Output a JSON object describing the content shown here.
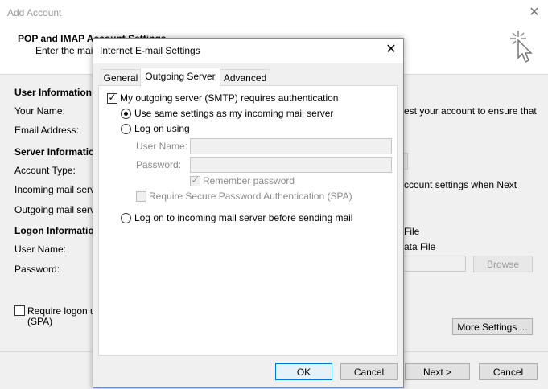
{
  "background_window": {
    "title": "Add Account",
    "header_title": "POP and IMAP Account Settings",
    "header_subtitle": "Enter the mail server settings for your account.",
    "sections": {
      "user_information": "User Information",
      "your_name": "Your Name:",
      "email_address": "Email Address:",
      "server_information": "Server Information",
      "account_type": "Account Type:",
      "incoming_mail_server": "Incoming mail server:",
      "outgoing_mail_server": "Outgoing mail server (SMTP):",
      "logon_information": "Logon Information",
      "user_name": "User Name:",
      "password": "Password:"
    },
    "right_text_1": "est your account to ensure that",
    "right_text_2": "ccount settings when Next",
    "right_text_3": "File",
    "right_text_4": "ata File",
    "browse_label": "Browse",
    "require_logon_label": "Require logon using Secure Password Authentication",
    "spa_label": "(SPA)",
    "more_settings_label": "More Settings ...",
    "next_label": "Next >",
    "cancel_label": "Cancel"
  },
  "dialog": {
    "title": "Internet E-mail Settings",
    "tabs": [
      {
        "label": "General",
        "active": false
      },
      {
        "label": "Outgoing Server",
        "active": true
      },
      {
        "label": "Advanced",
        "active": false
      }
    ],
    "smtp_auth_label": "My outgoing server (SMTP) requires authentication",
    "smtp_auth_checked": true,
    "use_same_settings_label": "Use same settings as my incoming mail server",
    "log_on_using_label": "Log on using",
    "user_name_label": "User Name:",
    "password_label": "Password:",
    "remember_password_label": "Remember password",
    "remember_password_checked": true,
    "require_spa_label": "Require Secure Password Authentication (SPA)",
    "log_on_incoming_label": "Log on to incoming mail server before sending mail",
    "selected_option": "Use same settings as my incoming mail server",
    "ok_label": "OK",
    "cancel_label": "Cancel"
  }
}
